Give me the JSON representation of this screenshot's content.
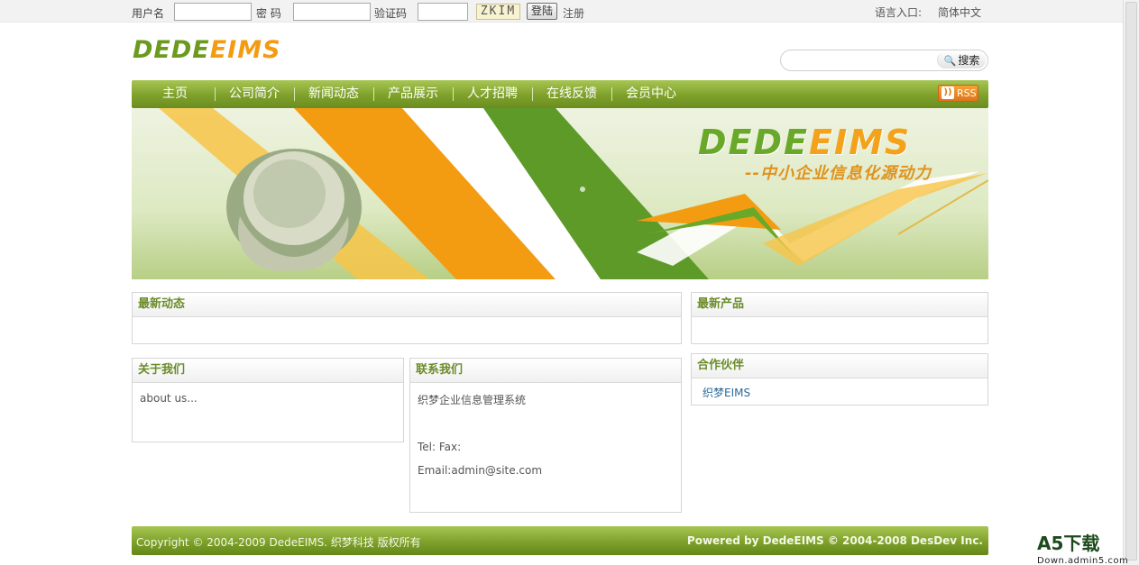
{
  "topbar": {
    "username_label": "用户名",
    "password_label": "密 码",
    "captcha_label": "验证码",
    "captcha_text": "ZKIM",
    "login_label": "登陆",
    "register_label": "注册",
    "language_label": "语言入口:",
    "language_value": "简体中文"
  },
  "logo": {
    "part1": "DEDE",
    "part2": "EIMS"
  },
  "search": {
    "button_label": "搜索",
    "placeholder": ""
  },
  "nav": {
    "items": [
      "主页",
      "公司简介",
      "新闻动态",
      "产品展示",
      "人才招聘",
      "在线反馈",
      "会员中心"
    ],
    "rss_label": "RSS"
  },
  "banner": {
    "logo_part1": "DEDE",
    "logo_part2": "EIMS",
    "slogan": "--中小企业信息化源动力"
  },
  "panels": {
    "news": {
      "title": "最新动态"
    },
    "products": {
      "title": "最新产品"
    },
    "about": {
      "title": "关于我们",
      "text": "about us..."
    },
    "contact": {
      "title": "联系我们",
      "company": "织梦企业信息管理系统",
      "phone": "Tel: Fax:",
      "email": "Email:admin@site.com"
    },
    "partners": {
      "title": "合作伙伴",
      "links": [
        "织梦EIMS"
      ]
    }
  },
  "footer": {
    "left": "Copyright © 2004-2009 DedeEIMS. 织梦科技 版权所有",
    "right": "Powered by DedeEIMS © 2004-2008 DesDev Inc."
  },
  "watermark": {
    "main": "A5下载",
    "sub": "Down.admin5.com"
  },
  "colors": {
    "green": "#7ea12b",
    "orange": "#f39c12",
    "title_green": "#6b8c2a"
  }
}
